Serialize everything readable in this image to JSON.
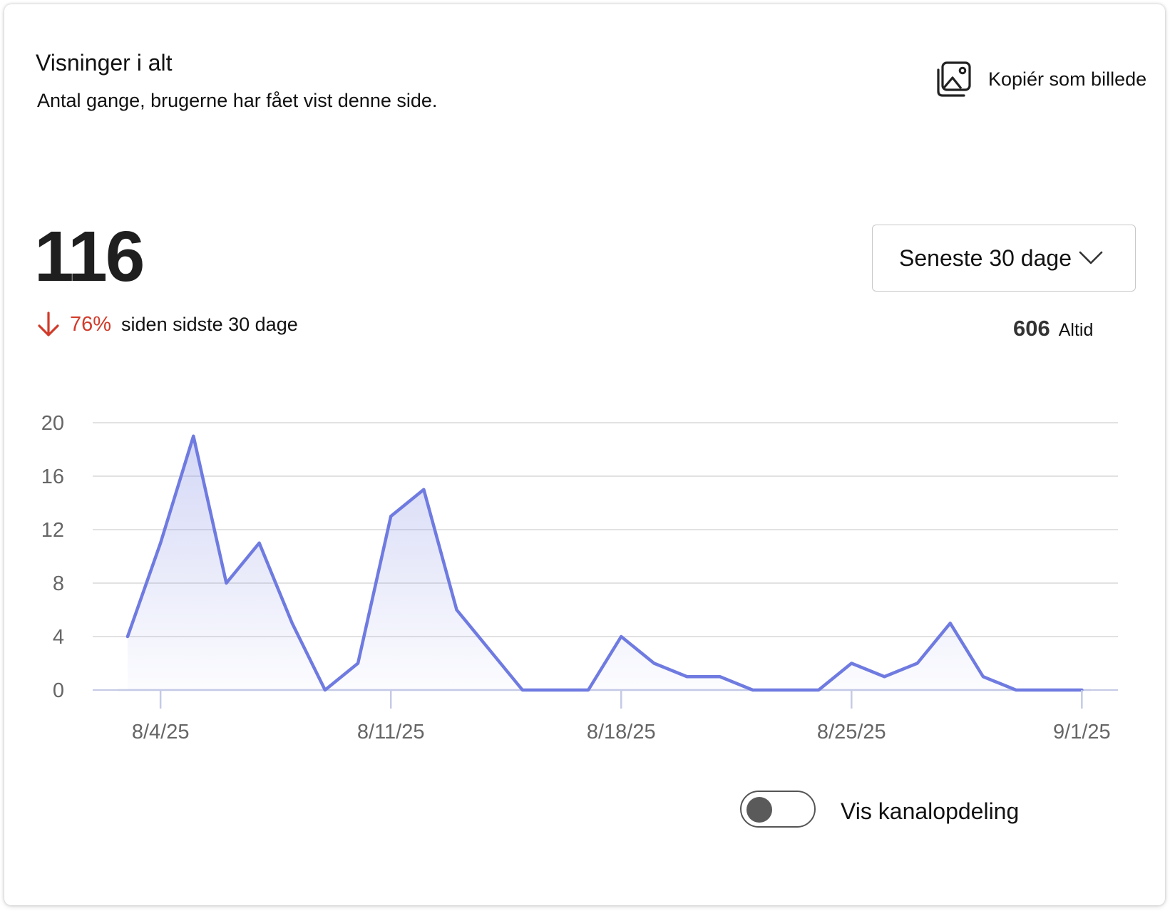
{
  "header": {
    "title": "Visninger i alt",
    "subtitle": "Antal gange, brugerne har fået vist denne side.",
    "copy_label": "Kopiér som billede",
    "copy_icon": "image-copy-icon"
  },
  "summary": {
    "total": "116",
    "trend_direction": "down",
    "trend_icon": "arrow-down-icon",
    "trend_percent": "76%",
    "trend_color": "#d13b2a",
    "trend_text": "siden sidste 30 dage",
    "alltime_value": "606",
    "alltime_label": "Altid"
  },
  "range_select": {
    "selected": "Seneste 30 dage",
    "icon": "chevron-down-icon"
  },
  "toggle": {
    "label": "Vis kanalopdeling",
    "checked": false
  },
  "chart_data": {
    "type": "area",
    "title": "",
    "xlabel": "",
    "ylabel": "",
    "x": [
      "8/3/25",
      "8/4/25",
      "8/5/25",
      "8/6/25",
      "8/7/25",
      "8/8/25",
      "8/9/25",
      "8/10/25",
      "8/11/25",
      "8/12/25",
      "8/13/25",
      "8/14/25",
      "8/15/25",
      "8/16/25",
      "8/17/25",
      "8/18/25",
      "8/19/25",
      "8/20/25",
      "8/21/25",
      "8/22/25",
      "8/23/25",
      "8/24/25",
      "8/25/25",
      "8/26/25",
      "8/27/25",
      "8/28/25",
      "8/29/25",
      "8/30/25",
      "8/31/25",
      "9/1/25"
    ],
    "series": [
      {
        "values": [
          4,
          11,
          19,
          8,
          11,
          5,
          0,
          2,
          13,
          15,
          6,
          3,
          0,
          0,
          0,
          4,
          2,
          1,
          1,
          0,
          0,
          0,
          2,
          1,
          2,
          5,
          1,
          0,
          0,
          0
        ]
      }
    ],
    "x_tick_labels": [
      "8/4/25",
      "8/11/25",
      "8/18/25",
      "8/25/25",
      "9/1/25"
    ],
    "y_ticks": [
      0,
      4,
      8,
      12,
      16,
      20
    ],
    "ylim": [
      0,
      20
    ],
    "grid": true,
    "line_color": "#6f7be0",
    "fill_color": "#6f7be0"
  }
}
